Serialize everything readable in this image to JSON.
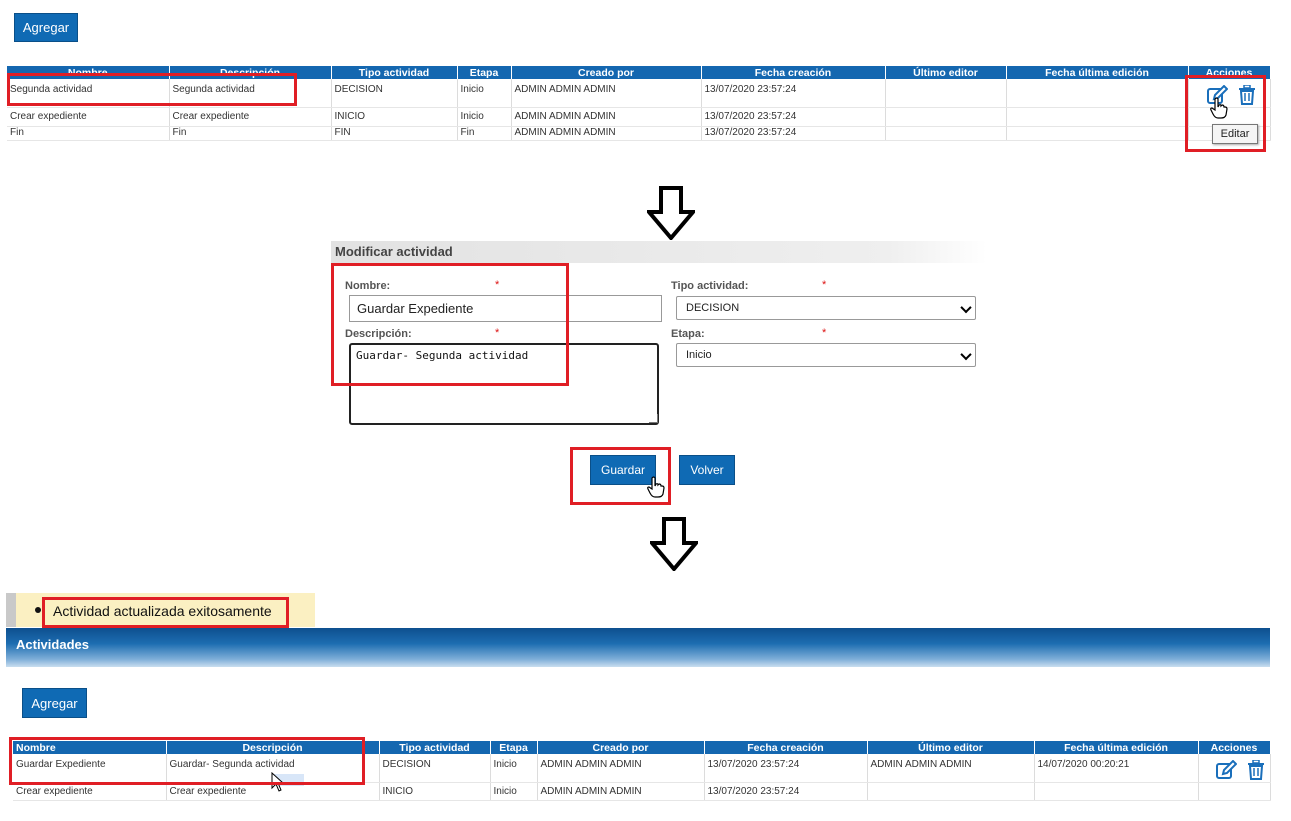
{
  "top": {
    "add_label": "Agregar",
    "headers": [
      "Nombre",
      "Descripción",
      "Tipo actividad",
      "Etapa",
      "Creado por",
      "Fecha creación",
      "Último editor",
      "Fecha última edición",
      "Acciones"
    ],
    "rows": [
      [
        "Segunda actividad",
        "Segunda actividad",
        "DECISION",
        "Inicio",
        "ADMIN ADMIN ADMIN",
        "13/07/2020 23:57:24",
        "",
        ""
      ],
      [
        "Crear expediente",
        "Crear expediente",
        "INICIO",
        "Inicio",
        "ADMIN ADMIN ADMIN",
        "13/07/2020 23:57:24",
        "",
        ""
      ],
      [
        "Fin",
        "Fin",
        "FIN",
        "Fin",
        "ADMIN ADMIN ADMIN",
        "13/07/2020 23:57:24",
        "",
        ""
      ]
    ],
    "tooltip": "Editar"
  },
  "form": {
    "title": "Modificar actividad",
    "nombre_label": "Nombre:",
    "nombre_value": "Guardar Expediente",
    "descripcion_label": "Descripción:",
    "descripcion_value": "Guardar- Segunda actividad",
    "tipo_label": "Tipo actividad:",
    "tipo_value": "DECISION",
    "etapa_label": "Etapa:",
    "etapa_value": "Inicio",
    "required_mark": "*",
    "save_label": "Guardar",
    "back_label": "Volver"
  },
  "result": {
    "message": "Actividad actualizada exitosamente",
    "section_title": "Actividades",
    "add_label": "Agregar",
    "headers": [
      "Nombre",
      "Descripción",
      "Tipo actividad",
      "Etapa",
      "Creado por",
      "Fecha creación",
      "Último editor",
      "Fecha última edición",
      "Acciones"
    ],
    "rows": [
      [
        "Guardar Expediente",
        "Guardar- Segunda actividad",
        "DECISION",
        "Inicio",
        "ADMIN ADMIN ADMIN",
        "13/07/2020 23:57:24",
        "ADMIN ADMIN ADMIN",
        "14/07/2020 00:20:21"
      ],
      [
        "Crear expediente",
        "Crear expediente",
        "INICIO",
        "Inicio",
        "ADMIN ADMIN ADMIN",
        "13/07/2020 23:57:24",
        "",
        ""
      ]
    ]
  },
  "colors": {
    "primary": "#0f6ab4",
    "highlight": "#e01e25",
    "message_bg": "#fbf0c2"
  },
  "icons": [
    "edit-icon",
    "trash-icon",
    "hand-cursor-icon",
    "arrow-down-icon",
    "arrow-cursor-icon"
  ]
}
